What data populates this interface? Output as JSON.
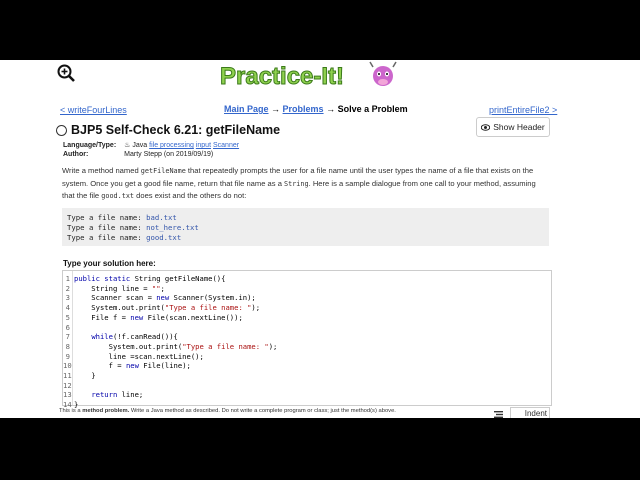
{
  "logo_text": "Practice-It!",
  "nav": {
    "prev": "< writeFourLines",
    "main_page": "Main Page",
    "arrow1": "→",
    "problems": "Problems",
    "arrow2": "→",
    "current": "Solve a Problem",
    "next": "printEntireFile2 >"
  },
  "problem": {
    "title": "BJP5 Self-Check 6.21: getFileName",
    "show_header": "Show Header",
    "meta": {
      "lang_label": "Language/Type:",
      "lang_java": "Java",
      "tags": [
        "file processing",
        "input",
        "Scanner"
      ],
      "author_label": "Author:",
      "author": "Marty Stepp (on 2019/09/19)"
    },
    "description": {
      "p1": "Write a method named ",
      "code1": "getFileName",
      "p2": " that repeatedly prompts the user for a file name until the user types the name of a file that exists on the system. Once you get a good file name, return that file name as a ",
      "code2": "String",
      "p3": ". Here is a sample dialogue from one call to your method, assuming that the file ",
      "code3": "good.txt",
      "p4": " does exist and the others do not:"
    },
    "sample": [
      {
        "prompt": "Type a file name: ",
        "value": "bad.txt"
      },
      {
        "prompt": "Type a file name: ",
        "value": "not_here.txt"
      },
      {
        "prompt": "Type a file name: ",
        "value": "good.txt"
      }
    ]
  },
  "solution_label": "Type your solution here:",
  "code_lines": [
    "public static String getFileName(){",
    "    String line = \"\";",
    "    Scanner scan = new Scanner(System.in);",
    "    System.out.print(\"Type a file name: \");",
    "    File f = new File(scan.nextLine());",
    "",
    "    while(!f.canRead()){",
    "        System.out.print(\"Type a file name: \");",
    "        line =scan.nextLine();",
    "        f = new File(line);",
    "    }",
    "",
    "    return line;",
    "}"
  ],
  "footnote": {
    "pre": "This is a ",
    "bold": "method problem.",
    "post": " Write a Java method as described. Do not write a complete program or class; just the method(s) above."
  },
  "indent_label": "Indent"
}
